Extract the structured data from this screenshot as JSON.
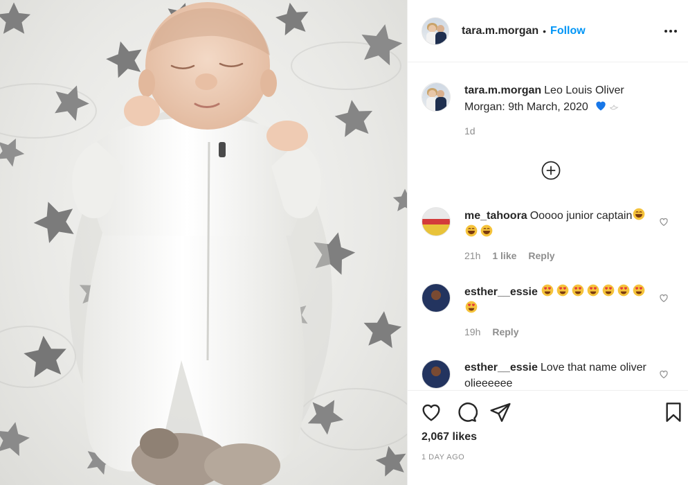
{
  "post": {
    "author": "tara.m.morgan",
    "follow_label": "Follow",
    "separator": "•",
    "caption_user": "tara.m.morgan",
    "caption_text": "Leo Louis Oliver Morgan: 9th March, 2020",
    "caption_time": "1d"
  },
  "comments": [
    {
      "user": "me_tahoora",
      "text": "Ooooo junior captain",
      "emojis": [
        "grin-emoji",
        "grin-emoji",
        "grin-emoji"
      ],
      "time": "21h",
      "likes": "1 like",
      "reply": "Reply"
    },
    {
      "user": "esther__essie",
      "text": "",
      "emojis": [
        "heart-eyes-emoji",
        "heart-eyes-emoji",
        "heart-eyes-emoji",
        "heart-eyes-emoji",
        "heart-eyes-emoji",
        "heart-eyes-emoji",
        "heart-eyes-emoji",
        "heart-eyes-emoji"
      ],
      "time": "19h",
      "reply": "Reply"
    },
    {
      "user": "esther__essie",
      "text": "Love that name oliver olieeeeee"
    }
  ],
  "footer": {
    "likes": "2,067 likes",
    "date": "1 DAY AGO"
  },
  "colors": {
    "link": "#0095f6",
    "text": "#262626",
    "muted": "#8e8e8e",
    "border": "#efefef"
  },
  "icons": {
    "more": "more-options-icon",
    "add_comment": "plus-circle-icon",
    "like": "heart-icon",
    "comment": "comment-bubble-icon",
    "share": "paper-plane-icon",
    "save": "bookmark-icon"
  }
}
